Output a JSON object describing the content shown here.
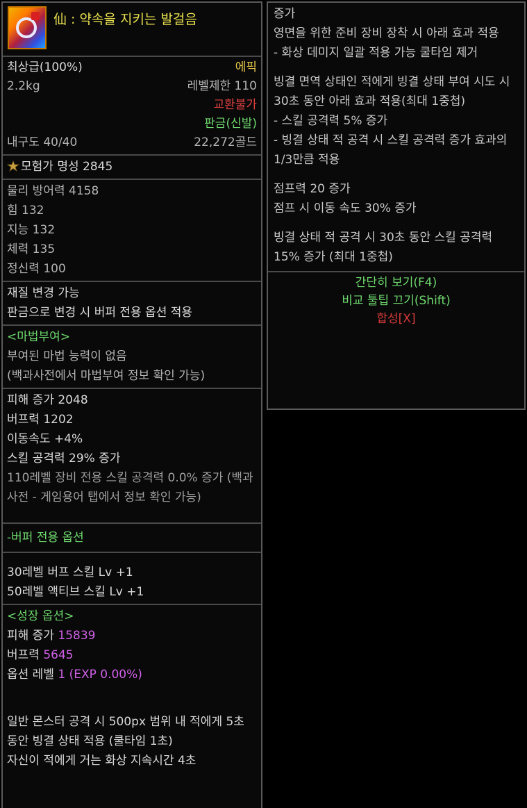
{
  "item": {
    "title": "仙 : 약속을 지키는 발걸음",
    "grade": "최상급(100%)",
    "rarity": "에픽",
    "weight": "2.2kg",
    "level_limit": "레벨제한 110",
    "trade": "교환불가",
    "type": "판금(신발)",
    "durability": "내구도 40/40",
    "price": "22,272골드",
    "fame": "모험가 명성 2845"
  },
  "stats": [
    "물리 방어력 4158",
    "힘 132",
    "지능 132",
    "체력 135",
    "정신력 100"
  ],
  "material": {
    "title": "재질 변경 가능",
    "desc": "판금으로 변경 시 버퍼 전용 옵션 적용"
  },
  "enchant": {
    "header": "<마법부여>",
    "none": "부여된 마법 능력이 없음",
    "hint": "(백과사전에서 마법부여 정보 확인 가능)"
  },
  "options": {
    "damage": "피해 증가 2048",
    "buff": "버프력 1202",
    "move": "이동속도 +4%",
    "skill_atk": "스킬 공격력 29% 증가",
    "note": "110레벨 장비 전용 스킬 공격력 0.0% 증가 (백과사전 - 게임용어 탭에서 정보 확인 가능)"
  },
  "buffer": {
    "header": "-버퍼 전용 옵션",
    "line1": "30레벨 버프 스킬 Lv +1",
    "line2": "50레벨 액티브 스킬 Lv +1"
  },
  "growth": {
    "header": "<성장 옵션>",
    "damage_label": "피해 증가 ",
    "damage_value": "15839",
    "buff_label": "버프력 ",
    "buff_value": "5645",
    "level_label": "옵션 레벨 ",
    "level_value": "1 (EXP 0.00%)",
    "effect1": "일반 몬스터 공격 시 500px 범위 내 적에게 5초 동안 빙결 상태 적용 (쿨타임 1초)",
    "effect2": "자신이 적에게 거는 화상 지속시간 4초"
  },
  "right": {
    "p1_l1": "증가",
    "p1_l2": "영면을 위한 준비 장비 장착 시 아래 효과 적용",
    "p1_l3": "- 화상 데미지 일괄 적용 가능 쿨타임 제거",
    "p2_l1": "빙결 면역 상태인 적에게 빙결 상태 부여 시도 시 30초 동안 아래 효과 적용(최대 1중첩)",
    "p2_l2": "- 스킬 공격력 5% 증가",
    "p2_l3": "- 빙결 상태 적 공격 시 스킬 공격력 증가 효과의 1/3만큼 적용",
    "p3_l1": "점프력 20 증가",
    "p3_l2": "점프 시 이동 속도 30% 증가",
    "p4_l1": "빙결 상태 적 공격 시 30초 동안 스킬 공격력 15% 증가 (최대 1중첩)",
    "simple_view": "간단히 보기(F4)",
    "compare_off": "비교 툴팁 끄기(Shift)",
    "combine": "합성[X]"
  },
  "colors": {
    "title": "#e8e050",
    "epic": "#e6c84c",
    "untradable": "#e04040",
    "green": "#6ed86e",
    "growth_value": "#d060e8",
    "combine": "#d63a3a"
  }
}
